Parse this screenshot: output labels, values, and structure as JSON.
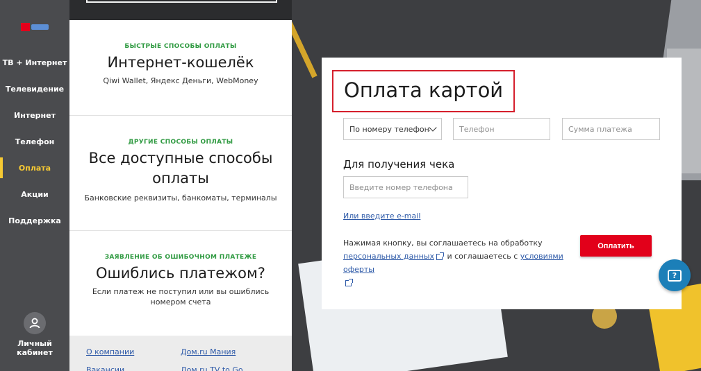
{
  "sidebar": {
    "nav": [
      {
        "label": "ТВ + Интернет"
      },
      {
        "label": "Телевидение"
      },
      {
        "label": "Интернет"
      },
      {
        "label": "Телефон"
      },
      {
        "label": "Оплата",
        "active": true
      },
      {
        "label": "Акции"
      },
      {
        "label": "Поддержка"
      }
    ],
    "account_line1": "Личный",
    "account_line2": "кабинет",
    "avatar_icon": "user-icon",
    "active_color": "#f6c933"
  },
  "panel": {
    "sections": [
      {
        "kicker": "БЫСТРЫЕ СПОСОБЫ ОПЛАТЫ",
        "title": "Интернет-кошелёк",
        "desc": "Qiwi Wallet, Яндекс Деньги, WebMoney"
      },
      {
        "kicker": "ДРУГИЕ СПОСОБЫ ОПЛАТЫ",
        "title_line1": "Все доступные способы",
        "title_line2": "оплаты",
        "desc": "Банковские реквизиты, банкоматы, терминалы"
      },
      {
        "kicker": "ЗАЯВЛЕНИЕ ОБ ОШИБОЧНОМ ПЛАТЕЖЕ",
        "title": "Ошиблись платежом?",
        "desc_line1": "Если платеж не поступил или вы ошиблись",
        "desc_line2": "номером счета"
      }
    ],
    "footer_links": [
      "О компании",
      "Дом.ru Мания",
      "Вакансии",
      "Дом.ru TV to Go"
    ]
  },
  "form": {
    "title": "Оплата картой",
    "search_by": "По номеру телефона",
    "phone_placeholder": "Телефон",
    "amount_placeholder": "Сумма платежа",
    "receipt_label": "Для получения чека",
    "receipt_phone_placeholder": "Введите номер телефона",
    "email_link": "Или введите e-mail",
    "consent_prefix": "Нажимая кнопку, вы соглашаетесь на обработку",
    "consent_link1": "персональных данных",
    "consent_middle": "и соглашаетесь с",
    "consent_link2": "условиями оферты",
    "pay_button": "Оплатить",
    "accent_color": "#e2001a"
  },
  "help_icon": "chat-help-icon",
  "help_glyph": "?"
}
